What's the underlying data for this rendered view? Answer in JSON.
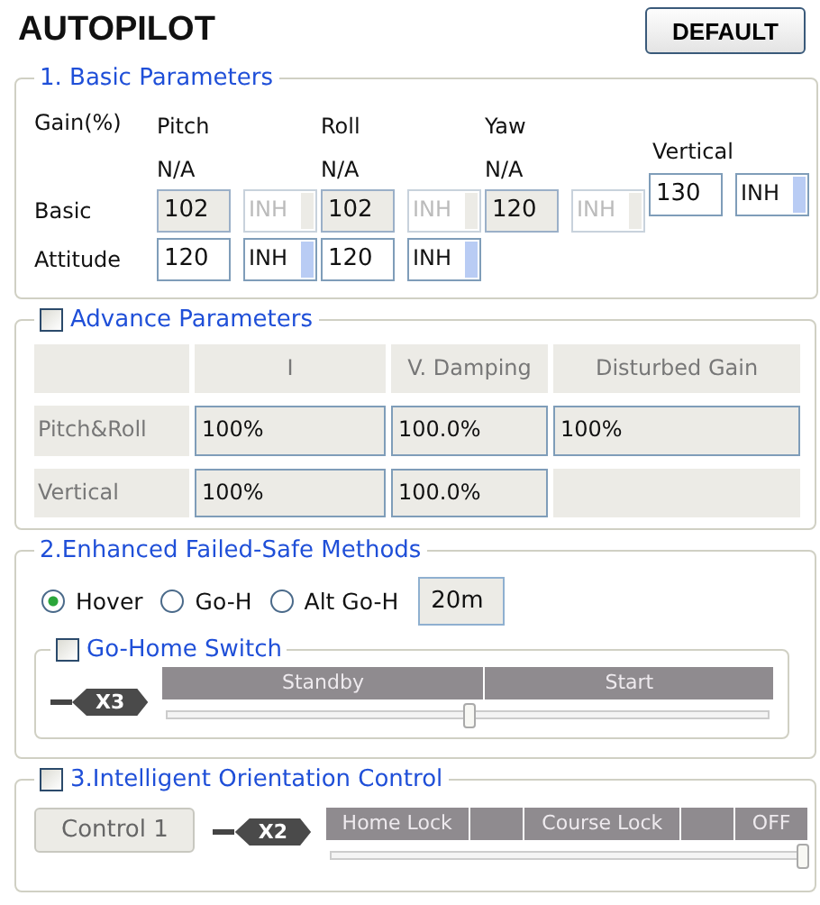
{
  "title": "AUTOPILOT",
  "default_button": "DEFAULT",
  "basic_parameters": {
    "title": "1. Basic Parameters",
    "gain_label": "Gain(%)",
    "columns": [
      {
        "name": "Pitch",
        "note": "N/A"
      },
      {
        "name": "Roll",
        "note": "N/A"
      },
      {
        "name": "Yaw",
        "note": "N/A"
      },
      {
        "name": "Vertical"
      }
    ],
    "rows": [
      {
        "label": "Basic",
        "cells": [
          {
            "value": "102",
            "mode": "INH",
            "disabled": true
          },
          {
            "value": "102",
            "mode": "INH",
            "disabled": true
          },
          {
            "value": "120",
            "mode": "INH",
            "disabled": true
          },
          {
            "value": "130",
            "mode": "INH",
            "disabled": false
          }
        ]
      },
      {
        "label": "Attitude",
        "cells": [
          {
            "value": "120",
            "mode": "INH",
            "disabled": false
          },
          {
            "value": "120",
            "mode": "INH",
            "disabled": false
          }
        ]
      }
    ]
  },
  "advance_parameters": {
    "title": "Advance Parameters",
    "checked": false,
    "columns": [
      "I",
      "V. Damping",
      "Disturbed Gain"
    ],
    "rows": [
      {
        "label": "Pitch&Roll",
        "cells": [
          "100%",
          "100.0%",
          "100%"
        ]
      },
      {
        "label": "Vertical",
        "cells": [
          "100%",
          "100.0%"
        ]
      }
    ]
  },
  "failsafe": {
    "title": "2.Enhanced Failed-Safe Methods",
    "options": [
      {
        "label": "Hover",
        "selected": true
      },
      {
        "label": "Go-H",
        "selected": false
      },
      {
        "label": "Alt Go-H",
        "selected": false
      }
    ],
    "altitude": "20m",
    "go_home_switch": {
      "title": "Go-Home Switch",
      "checked": false,
      "channel": "X3",
      "positions": [
        {
          "kind": "label",
          "label": "Standby"
        },
        {
          "kind": "label",
          "label": "Start"
        }
      ],
      "level": 0.5
    }
  },
  "orientation_control": {
    "title": "3.Intelligent Orientation Control",
    "checked": false,
    "button": "Control 1",
    "channel": "X2",
    "positions": [
      {
        "kind": "label",
        "label": "Home Lock"
      },
      {
        "kind": "gap"
      },
      {
        "kind": "label",
        "label": "Course Lock"
      },
      {
        "kind": "gap"
      },
      {
        "kind": "label",
        "label": "OFF"
      }
    ],
    "level": 1
  }
}
